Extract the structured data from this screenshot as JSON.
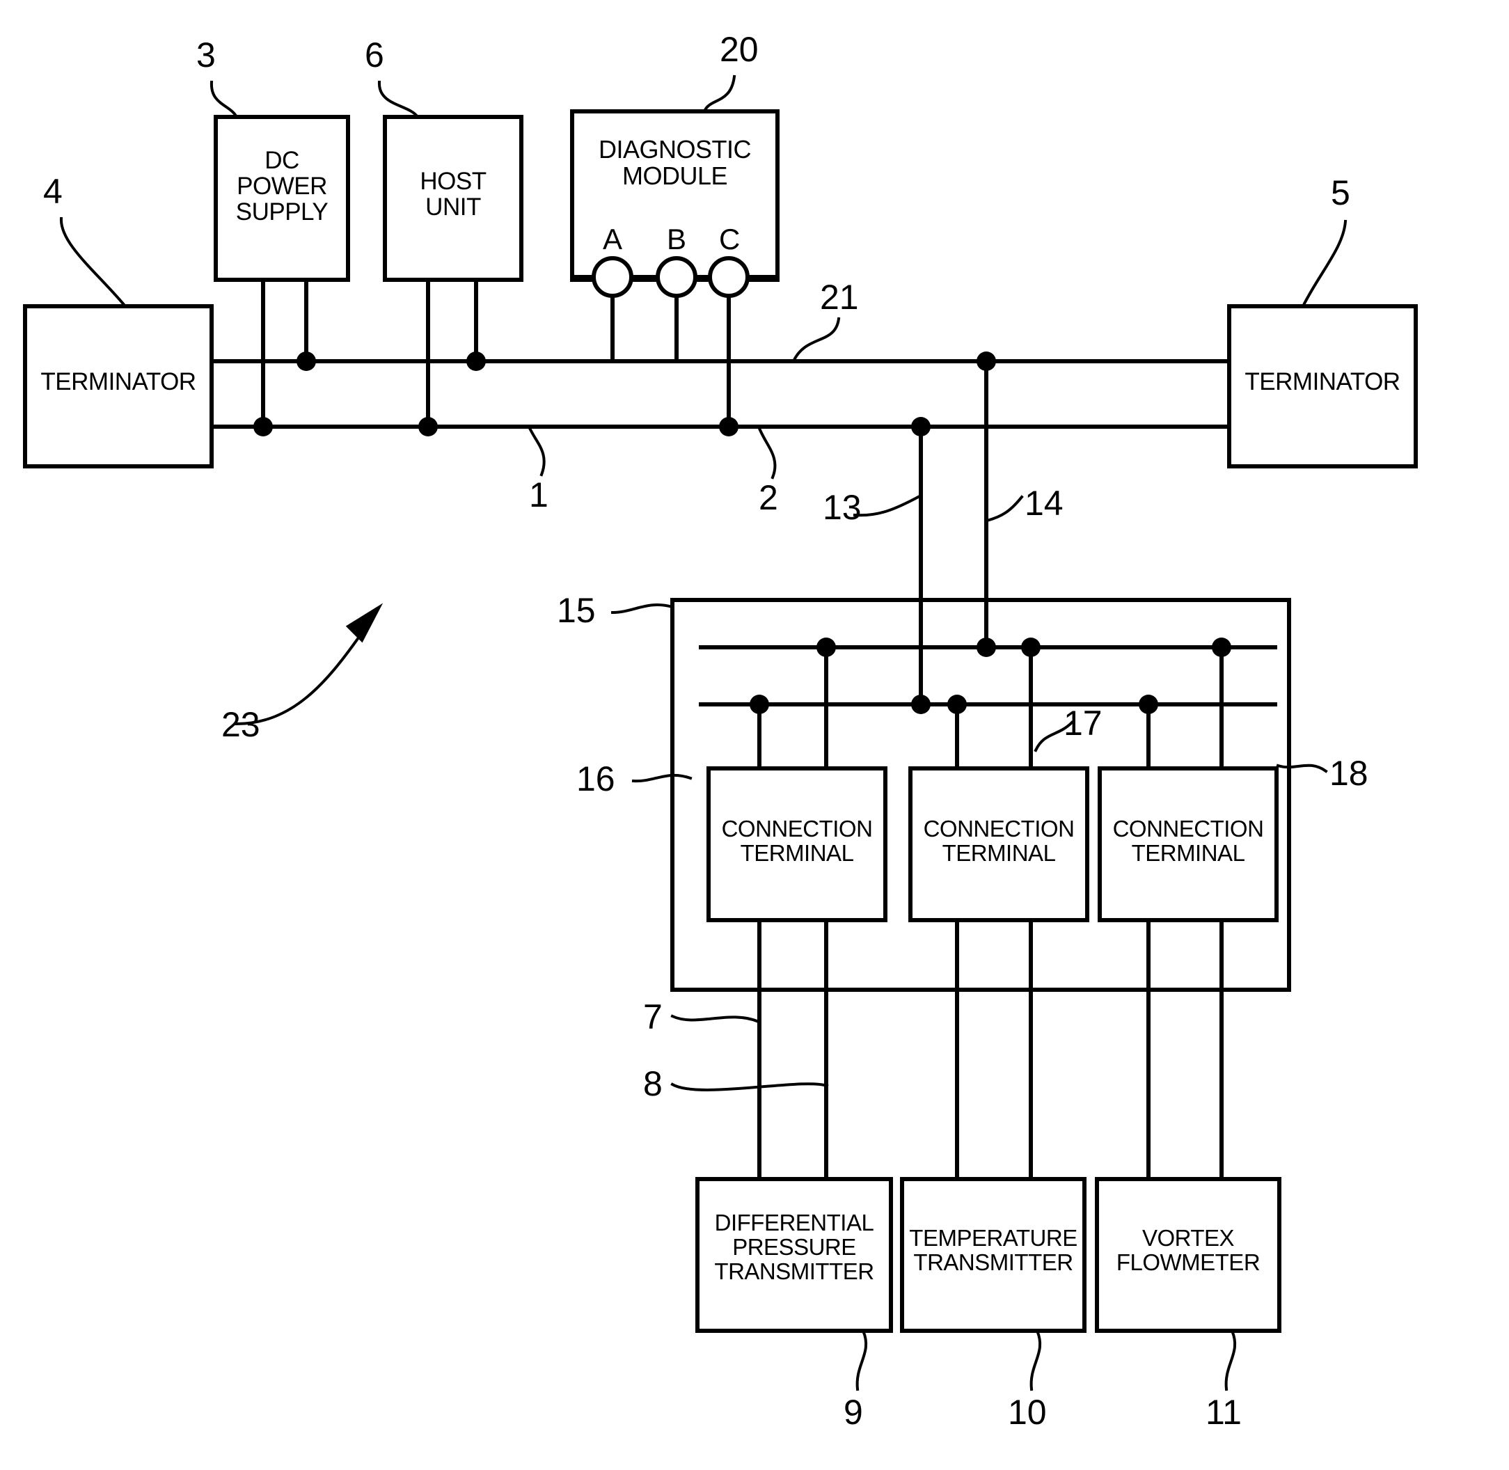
{
  "figure": {
    "kind": "patent-schematic",
    "title": "Fieldbus segment diagnostic schematic"
  },
  "blocks": {
    "terminator_left": {
      "label": "TERMINATOR"
    },
    "terminator_right": {
      "label": "TERMINATOR"
    },
    "dc_power_supply": {
      "label": "DC\nPOWER\nSUPPLY"
    },
    "host_unit": {
      "label": "HOST\nUNIT"
    },
    "diagnostic_module": {
      "label": "DIAGNOSTIC\nMODULE"
    },
    "connection_terminal_1": {
      "label": "CONNECTION\nTERMINAL"
    },
    "connection_terminal_2": {
      "label": "CONNECTION\nTERMINAL"
    },
    "connection_terminal_3": {
      "label": "CONNECTION\nTERMINAL"
    },
    "differential_pressure_transmitter": {
      "label": "DIFFERENTIAL\nPRESSURE\nTRANSMITTER"
    },
    "temperature_transmitter": {
      "label": "TEMPERATURE\nTRANSMITTER"
    },
    "vortex_flowmeter": {
      "label": "VORTEX\nFLOWMETER"
    }
  },
  "terminals": {
    "a": "A",
    "b": "B",
    "c": "C"
  },
  "reference_numerals": {
    "n1": "1",
    "n2": "2",
    "n3": "3",
    "n4": "4",
    "n5": "5",
    "n6": "6",
    "n7": "7",
    "n8": "8",
    "n9": "9",
    "n10": "10",
    "n11": "11",
    "n13": "13",
    "n14": "14",
    "n15": "15",
    "n16": "16",
    "n17": "17",
    "n18": "18",
    "n20": "20",
    "n21": "21",
    "n23": "23"
  },
  "colors": {
    "line": "#000000",
    "background": "#ffffff"
  }
}
